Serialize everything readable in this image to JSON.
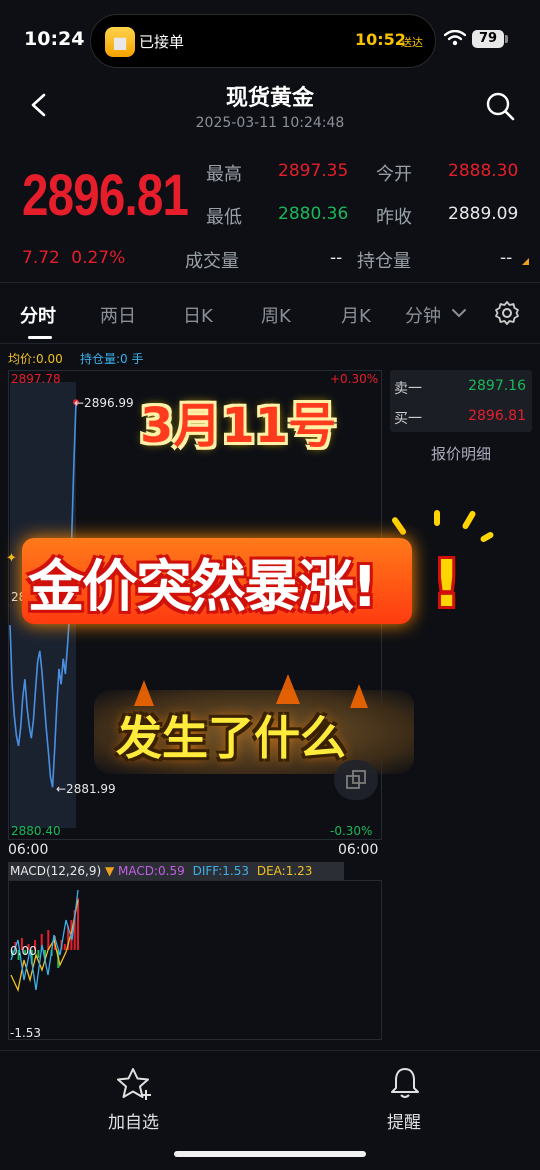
{
  "status_bar": {
    "time": "10:24",
    "island_status": "已接单",
    "island_eta": "10:52",
    "island_eta_label": "送达",
    "battery": "79"
  },
  "header": {
    "title": "现货黄金",
    "datetime": "2025-03-11 10:24:48"
  },
  "quote": {
    "price": "2896.81",
    "change": "7.72",
    "change_pct": "0.27%",
    "high_label": "最高",
    "high": "2897.35",
    "low_label": "最低",
    "low": "2880.36",
    "open_label": "今开",
    "open": "2888.30",
    "prev_close_label": "昨收",
    "prev_close": "2889.09",
    "volume_label": "成交量",
    "volume": "--",
    "open_interest_label": "持仓量",
    "open_interest": "--"
  },
  "tabs": [
    "分时",
    "两日",
    "日K",
    "周K",
    "月K",
    "分钟"
  ],
  "indicators": {
    "avg_price": "均价:0.00",
    "position": "持仓量:0 手"
  },
  "chart": {
    "y_top": "2897.78",
    "y_bottom": "2880.40",
    "pct_top": "+0.30%",
    "pct_bottom": "-0.30%",
    "mid_left": "28",
    "x_left": "06:00",
    "x_right": "06:00",
    "marker_high": "←2896.99",
    "marker_low": "←2881.99"
  },
  "order_book": {
    "ask_label": "卖一",
    "ask": "2897.16",
    "bid_label": "买一",
    "bid": "2896.81",
    "detail_link": "报价明细"
  },
  "macd": {
    "name": "MACD(12,26,9)",
    "macd": "MACD:0.59",
    "diff": "DIFF:1.53",
    "dea": "DEA:1.23",
    "zero": "0.00",
    "low": "-1.53"
  },
  "overlay": {
    "date": "3月11号",
    "headline": "金价突然暴涨!",
    "exclaim": "!",
    "question": "发生了什么"
  },
  "bottom_bar": {
    "watchlist": "加自选",
    "alert": "提醒"
  },
  "colors": {
    "up": "#e61e2b",
    "down": "#19b85a",
    "background": "#0d0f14",
    "price_line": "#4a90e2"
  },
  "chart_data": {
    "type": "line",
    "title": "",
    "xlabel": "",
    "ylabel": "",
    "ylim": [
      2880.4,
      2897.78
    ],
    "x": [
      0,
      1,
      2,
      3,
      4,
      5,
      6,
      7,
      8,
      9,
      10,
      11,
      12,
      13,
      14,
      15,
      16,
      17,
      18,
      19,
      20,
      21,
      22,
      23,
      24,
      25,
      26,
      27,
      28,
      29,
      30,
      31
    ],
    "series": [
      {
        "values": [
          2888.3,
          2886.0,
          2884.8,
          2884.0,
          2883.6,
          2884.3,
          2885.5,
          2886.2,
          2885.1,
          2884.4,
          2883.9,
          2884.6,
          2885.8,
          2886.9,
          2887.3,
          2886.5,
          2885.4,
          2884.3,
          2883.4,
          2882.4,
          2881.99,
          2883.5,
          2885.2,
          2886.6,
          2886.0,
          2887.0,
          2886.4,
          2887.5,
          2888.8,
          2891.8,
          2894.6,
          2896.99
        ]
      }
    ]
  }
}
